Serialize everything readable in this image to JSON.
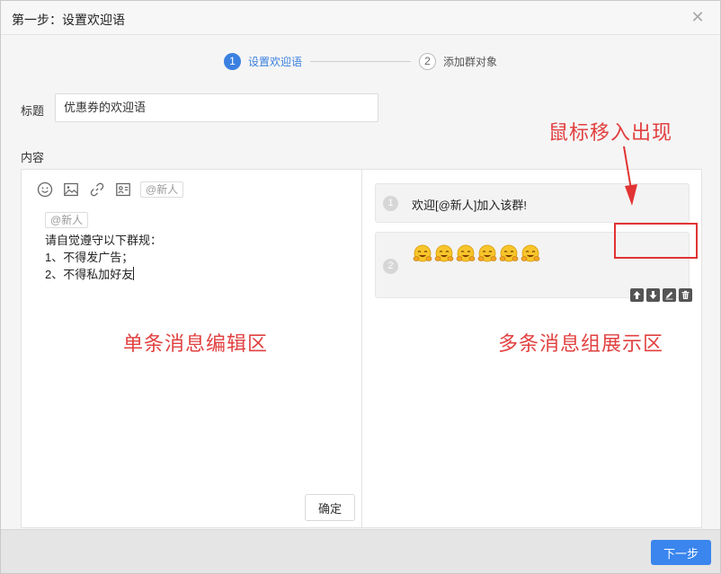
{
  "dialog": {
    "title": "第一步：设置欢迎语",
    "close_symbol": "✕"
  },
  "steps": [
    {
      "num": "1",
      "label": "设置欢迎语",
      "state": "active"
    },
    {
      "num": "2",
      "label": "添加群对象",
      "state": "inactive"
    }
  ],
  "form": {
    "title_label": "标题",
    "title_value": "优惠券的欢迎语",
    "content_label": "内容"
  },
  "editor": {
    "toolbar": {
      "icons": [
        "smiley-icon",
        "image-icon",
        "link-icon",
        "contact-card-icon"
      ],
      "mention_button": "@新人"
    },
    "mention_tag": "@新人",
    "lines": [
      "请自觉遵守以下群规：",
      "1、不得发广告；",
      "2、不得私加好友"
    ],
    "confirm_label": "确定"
  },
  "preview": {
    "messages": [
      {
        "index": "1",
        "text": "欢迎[@新人]加入该群!"
      },
      {
        "index": "2",
        "emoji": "hugging-face-icon",
        "emoji_count": 6
      }
    ],
    "actions": [
      "move-up-icon",
      "move-down-icon",
      "edit-icon",
      "delete-icon"
    ]
  },
  "annotations": {
    "hover_hint": "鼠标移入出现",
    "editor_zone": "单条消息编辑区",
    "preview_zone": "多条消息组展示区",
    "color": "#e24040"
  },
  "footer": {
    "next_label": "下一步"
  },
  "colors": {
    "accent": "#3a80e0",
    "button_primary": "#3a85ee",
    "highlight_box": "#e23333"
  }
}
